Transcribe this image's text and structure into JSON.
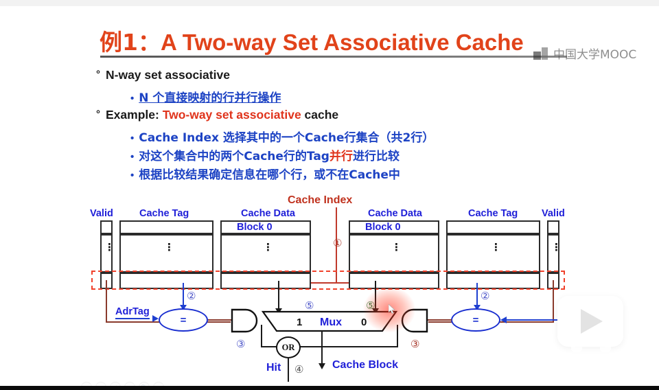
{
  "slide": {
    "title_cn": "例1：",
    "title_en": "A Two-way Set Associative Cache",
    "watermark": "中国大学MOOC"
  },
  "bullets": [
    {
      "level": 1,
      "marker": "°",
      "text": "N-way set associative"
    },
    {
      "level": 2,
      "marker": "•",
      "text": "N 个直接映射的行并行操作",
      "underline_part": "直接映射"
    },
    {
      "level": 1,
      "marker": "°",
      "prefix": "Example: ",
      "highlight": "Two-way set associative",
      "suffix": " cache"
    },
    {
      "level": 2,
      "marker": "•",
      "text": "Cache Index 选择其中的一个Cache行集合（共2行）"
    },
    {
      "level": 2,
      "marker": "•",
      "pre": "对这个集合中的两个Cache行的Tag",
      "red": "并行",
      "post": "进行比较"
    },
    {
      "level": 2,
      "marker": "•",
      "text": "根据比较结果确定信息在哪个行，或不在Cache中"
    }
  ],
  "diagram": {
    "column_headers": {
      "valid_left": "Valid",
      "cache_tag_left": "Cache Tag",
      "cache_data_left": "Cache Data",
      "cache_data_right": "Cache Data",
      "cache_tag_right": "Cache Tag",
      "valid_right": "Valid"
    },
    "cache_index_label": "Cache Index",
    "block_left": "Block 0",
    "block_right": "Block 0",
    "vertical_dots": "⋮",
    "adr_tag_label": "AdrTag",
    "comparator_symbol": "=",
    "mux_label": "Mux",
    "mux_input_1": "1",
    "mux_input_0": "0",
    "or_gate_label": "OR",
    "hit_label": "Hit",
    "cache_block_label": "Cache Block",
    "step_markers": {
      "m1": "①",
      "m2_left": "②",
      "m2_right": "②",
      "m3_left": "③",
      "m3_right": "③",
      "m4": "④",
      "m5_left": "⑤",
      "m5_right": "⑤"
    }
  },
  "colors": {
    "title_orange": "#e1431a",
    "bullet_blue": "#1d43c4",
    "accent_red": "#e0341c",
    "dashed_red": "#f0402a",
    "wire_brown": "#8a3a2c"
  },
  "toolbar": {
    "icons": [
      "back-icon",
      "play-icon",
      "pen-icon",
      "pointer-icon",
      "zoom-icon",
      "more-icon"
    ]
  },
  "overlay": {
    "play_button": "play-button"
  }
}
